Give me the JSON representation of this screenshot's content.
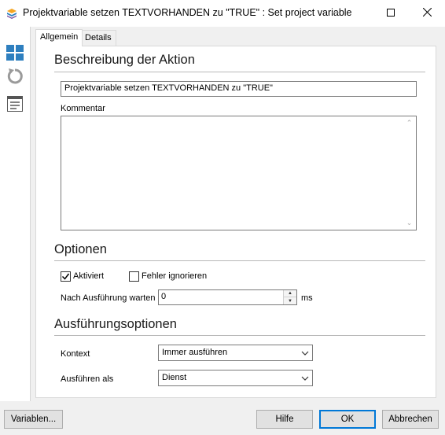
{
  "window": {
    "title": "Projektvariable setzen TEXTVORHANDEN zu \"TRUE\" : Set project variable",
    "minimize_icon": "minimize-icon",
    "maximize_icon": "maximize-icon",
    "close_icon": "close-icon"
  },
  "left_toolbar": {
    "items": [
      "layout-grid-icon",
      "undo-icon",
      "properties-list-icon"
    ]
  },
  "tabs": [
    {
      "label": "Allgemein",
      "active": true
    },
    {
      "label": "Details",
      "active": false
    }
  ],
  "description": {
    "heading": "Beschreibung der Aktion",
    "name_value": "Projektvariable setzen TEXTVORHANDEN zu \"TRUE\"",
    "comment_label": "Kommentar",
    "comment_value": ""
  },
  "options": {
    "heading": "Optionen",
    "activated_label": "Aktiviert",
    "activated_checked": true,
    "ignore_errors_label": "Fehler ignorieren",
    "ignore_errors_checked": false,
    "wait_label": "Nach Ausführung warten",
    "wait_value": "0",
    "wait_unit": "ms"
  },
  "execution": {
    "heading": "Ausführungsoptionen",
    "context_label": "Kontext",
    "context_value": "Immer ausführen",
    "run_as_label": "Ausführen als",
    "run_as_value": "Dienst"
  },
  "buttons": {
    "variables": "Variablen...",
    "help": "Hilfe",
    "ok": "OK",
    "cancel": "Abbrechen"
  },
  "colors": {
    "accent": "#2e7fbf",
    "default_button_border": "#0078d7"
  }
}
